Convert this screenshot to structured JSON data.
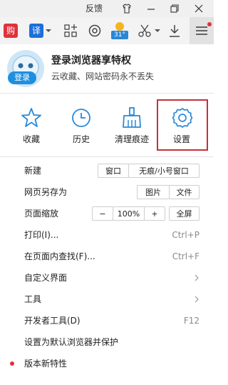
{
  "titlebar": {
    "feedback": "反馈",
    "tshirt_icon": "tshirt-icon",
    "minimize_icon": "minimize-icon",
    "restore_icon": "restore-icon",
    "close_icon": "close-icon"
  },
  "toolbar": {
    "shop_label": "购",
    "translate_label": "译",
    "weather_temp": "31°",
    "icons": [
      "shopping-icon",
      "translate-icon",
      "chevron-down-icon",
      "apps-icon",
      "at-icon",
      "weather-icon",
      "scissors-icon",
      "chevron-down-icon",
      "download-icon",
      "menu-icon"
    ]
  },
  "user": {
    "avatar": "avatar-icon",
    "login_badge": "登录",
    "title": "登录浏览器享特权",
    "subtitle": "云收藏、网站密码永不丢失"
  },
  "quick_actions": [
    {
      "label": "收藏",
      "icon": "star-icon"
    },
    {
      "label": "历史",
      "icon": "clock-icon"
    },
    {
      "label": "清理痕迹",
      "icon": "broom-icon"
    },
    {
      "label": "设置",
      "icon": "gear-icon",
      "highlighted": true
    }
  ],
  "menu": {
    "new": {
      "label": "新建",
      "buttons": [
        "窗口",
        "无痕/小号窗口"
      ]
    },
    "save_as": {
      "label": "网页另存为",
      "buttons": [
        "图片",
        "文件"
      ]
    },
    "zoom": {
      "label": "页面缩放",
      "minus": "−",
      "value": "100%",
      "plus": "+",
      "fullscreen": "全屏"
    },
    "print": {
      "label": "打印(I)...",
      "shortcut": "Ctrl+P"
    },
    "find": {
      "label": "在页面内查找(F)...",
      "shortcut": "Ctrl+F"
    },
    "customize": {
      "label": "自定义界面"
    },
    "tools": {
      "label": "工具"
    },
    "devtools": {
      "label": "开发者工具(D)",
      "shortcut": "F12"
    },
    "set_default": {
      "label": "设置为默认浏览器并保护"
    },
    "new_features": {
      "label": "版本新特性"
    }
  },
  "colors": {
    "accent": "#1e8fe0",
    "highlight": "#c6303a",
    "shop_red": "#e0323c",
    "translate_blue": "#1e6fd9"
  }
}
